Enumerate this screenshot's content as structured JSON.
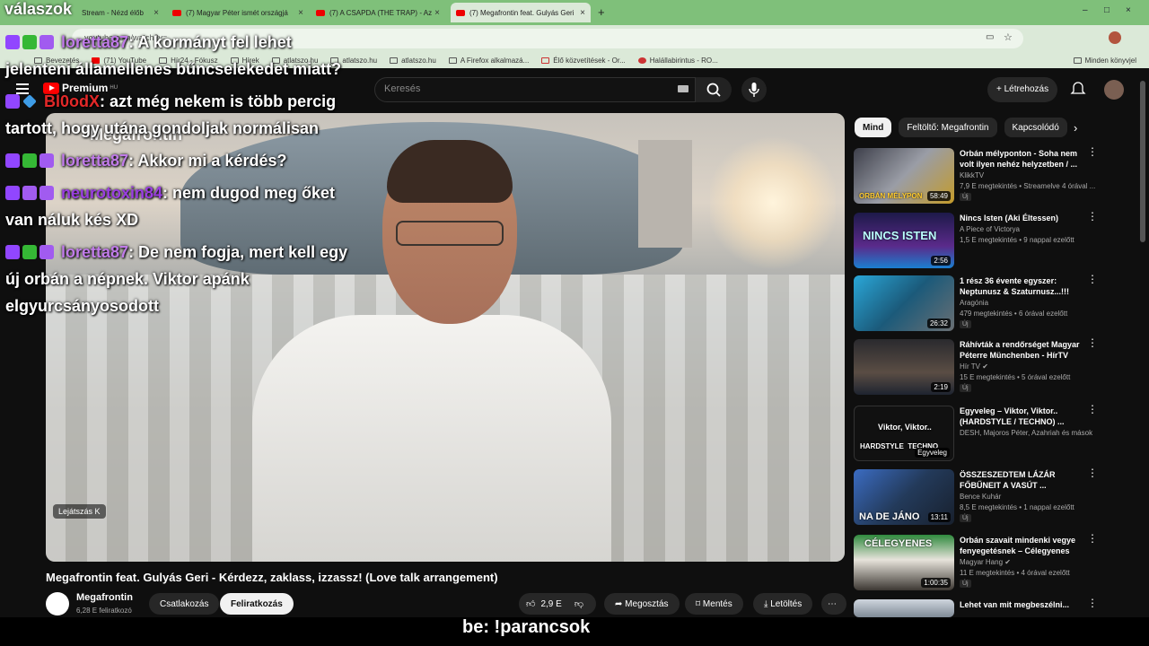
{
  "browser": {
    "tabs": [
      {
        "label": "Stream - Nézd élőb"
      },
      {
        "label": "(7) Magyar Péter ismét országjá"
      },
      {
        "label": "(7) A CSAPDA (THE TRAP) - Az"
      },
      {
        "label": "(7) Megafrontin feat. Gulyás Geri"
      }
    ],
    "new_tab": "+",
    "url": "youtube.com/watch?v=...",
    "bookmarks": [
      "Bevezetés",
      "(71) YouTube",
      "Hír24 - Fókusz",
      "Hírek",
      "atlatszo.hu",
      "atlatszo.hu",
      "atlatszo.hu",
      "A Firefox alkalmazá...",
      "Élő közvetítések - Or...",
      "Halállabirintus - RO..."
    ],
    "bookmarks_right": "Minden könyvjel"
  },
  "youtube": {
    "logo_text": "Premium",
    "logo_region": "HU",
    "search_placeholder": "Keresés",
    "create_label": "Létrehozás"
  },
  "video": {
    "overlay_hint": "Lejátszás",
    "overlay_key": "K",
    "title": "Megafrontin feat. Gulyás Geri - Kérdezz, zaklass, izzassz! (Love talk arrangement)",
    "channel": "Megafrontin",
    "subscribers": "6,28 E feliratkozó",
    "join_label": "Csatlakozás",
    "subscribe_label": "Feliratkozás",
    "likes": "2,9 E",
    "share_label": "Megosztás",
    "save_label": "Mentés",
    "download_label": "Letöltés"
  },
  "overlay": {
    "header": "válaszok",
    "ghost_text": "Megafrontin",
    "command": "be: !parancsok",
    "chat": [
      {
        "user": "loretta87",
        "text": ": A kormányt fel lehet"
      },
      {
        "text": "jelenteni államellenes bűncselekedet miatt?"
      },
      {
        "user": "Bl0odX",
        "text": ": azt még nekem is több percig"
      },
      {
        "text": "tartott, hogy utána gondoljak normálisan"
      },
      {
        "user": "loretta87",
        "text": ": Akkor mi a kérdés?"
      },
      {
        "user": "neurotoxin84",
        "text": ": nem dugod meg őket"
      },
      {
        "text": "van náluk kés XD"
      },
      {
        "user": "loretta87",
        "text": ": De nem fogja, mert kell egy"
      },
      {
        "text": "új orbán a népnek. Viktor apánk"
      },
      {
        "text": "elgyurcsányosodott"
      }
    ]
  },
  "sidebar": {
    "chips": [
      "Mind",
      "Feltöltő: Megafrontin",
      "Kapcsolódó"
    ],
    "recommendations": [
      {
        "title": "Orbán mélyponton - Soha nem volt ilyen nehéz helyzetben / ...",
        "channel": "KlikkTV",
        "meta": "7,9 E megtekintés • Streamelve 4 órával ...",
        "badge": "Új",
        "duration": "58:49",
        "thumb_text": "ORBÁN MÉLYPON"
      },
      {
        "title": "Nincs Isten (Aki Éltessen)",
        "channel": "A Piece of Victorya",
        "meta": "1,5 E megtekintés • 9 nappal ezelőtt",
        "badge": "",
        "duration": "2:56",
        "thumb_text": "NINCS ISTEN"
      },
      {
        "title": "1 rész 36 évente egyszer: Neptunusz & Szaturnusz...!!!",
        "channel": "Aragónia",
        "meta": "479 megtekintés • 6 órával ezelőtt",
        "badge": "Új",
        "duration": "26:32",
        "thumb_text": ""
      },
      {
        "title": "Ráhívták a rendőrséget Magyar Péterre Münchenben - HírTV",
        "channel": "Hír TV",
        "meta": "15 E megtekintés • 5 órával ezelőtt",
        "badge": "Új",
        "duration": "2:19",
        "thumb_text": ""
      },
      {
        "title": "Egyveleg – Viktor, Viktor.. (HARDSTYLE / TECHNO) ...",
        "channel": "DESH, Majoros Péter, Azahriah és mások",
        "meta": "",
        "badge": "",
        "duration": "Egyveleg",
        "thumb_text": "Viktor, Viktor.."
      },
      {
        "title": "ÖSSZESZEDTEM LÁZÁR FŐBŰNEIT A VASÚT ...",
        "channel": "Bence Kuhár",
        "meta": "8,5 E megtekintés • 1 nappal ezelőtt",
        "badge": "Új",
        "duration": "13:11",
        "thumb_text": "NA DE JÁNO"
      },
      {
        "title": "Orbán szavait mindenki vegye fenyegetésnek – Célegyenes",
        "channel": "Magyar Hang",
        "meta": "11 E megtekintés • 4 órával ezelőtt",
        "badge": "Új",
        "duration": "1:00:35",
        "thumb_text": "CÉLEGYENES"
      },
      {
        "title": "Lehet van mit megbeszélni...",
        "channel": "",
        "meta": "",
        "badge": "",
        "duration": "",
        "thumb_text": ""
      }
    ]
  }
}
